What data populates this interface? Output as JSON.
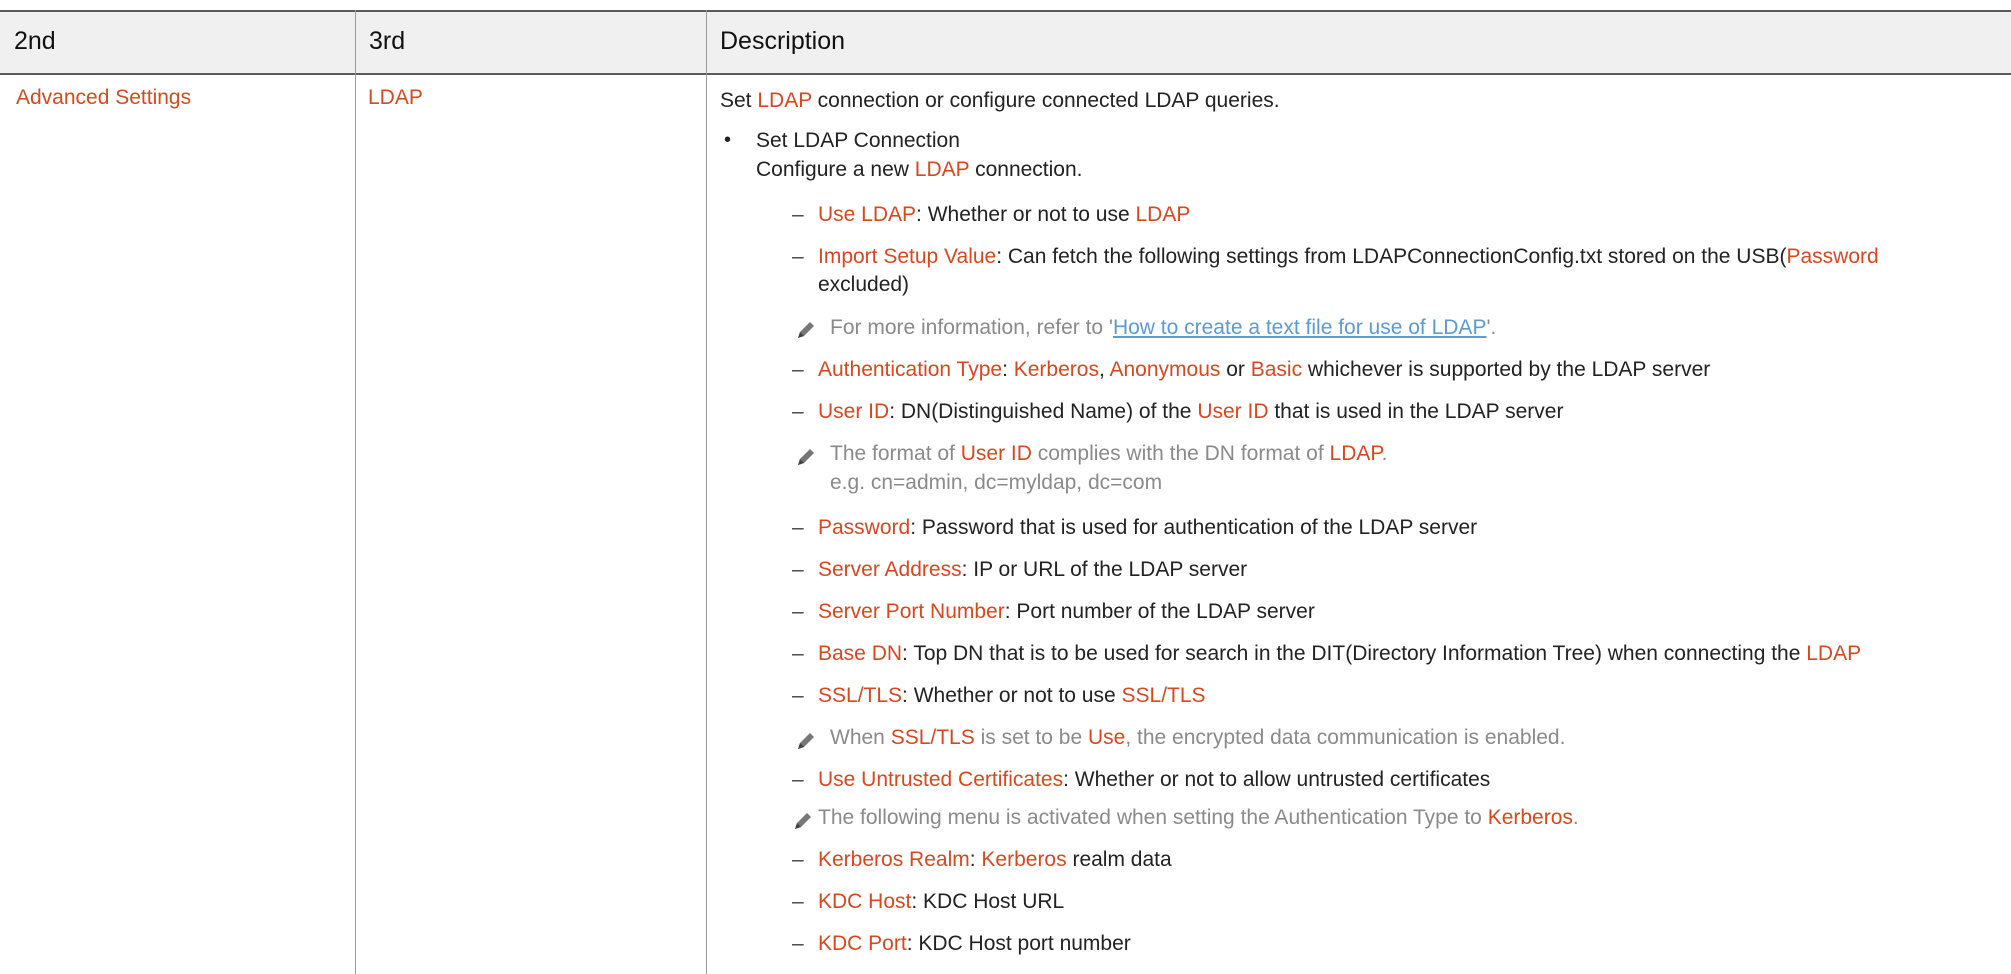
{
  "header": {
    "col_2nd": "2nd",
    "col_3rd": "3rd",
    "col_desc": "Description"
  },
  "row": {
    "second": "Advanced Settings",
    "third": "LDAP"
  },
  "desc": {
    "intro_pre": "Set ",
    "intro_ldap": "LDAP",
    "intro_post": " connection or configure connected LDAP queries.",
    "bullet_title": "Set LDAP Connection",
    "bullet_sub_pre": "Configure a new ",
    "bullet_sub_ldap": "LDAP",
    "bullet_sub_post": " connection.",
    "use_ldap_label": "Use LDAP",
    "use_ldap_text": ": Whether or not to use ",
    "use_ldap_ldap": "LDAP",
    "import_label": "Import Setup Value",
    "import_text": ": Can fetch the following settings from LDAPConnectionConfig.txt stored on the USB(",
    "import_password": "Password",
    "import_excluded": "excluded)",
    "note1_pre": "For more information, refer to '",
    "note1_link": "How to create a text file for use of LDAP",
    "note1_post": "'.",
    "auth_label": "Authentication Type",
    "auth_sep": ": ",
    "auth_kerberos": "Kerberos",
    "auth_comma": ", ",
    "auth_anonymous": "Anonymous",
    "auth_or": " or ",
    "auth_basic": "Basic",
    "auth_post": " whichever is supported by the LDAP server",
    "userid_label": "User ID",
    "userid_text": ": DN(Distinguished Name) of the ",
    "userid_userid": "User ID",
    "userid_post": " that is used in the LDAP server",
    "note2_pre": "The format of ",
    "note2_userid": "User ID",
    "note2_mid": " complies with the DN format of ",
    "note2_ldap": "LDAP",
    "note2_post": ".",
    "note2_example": "e.g. cn=admin, dc=myldap, dc=com",
    "password_label": "Password",
    "password_text": ": Password that is used for authentication of the LDAP server",
    "server_label": "Server Address",
    "server_text": ": IP or URL of the LDAP server",
    "port_label": "Server Port Number",
    "port_text": ": Port number of the LDAP server",
    "basedn_label": "Base DN",
    "basedn_text": ": Top DN that is to be used for search in the DIT(Directory Information Tree) when connecting the ",
    "basedn_ldap": "LDAP",
    "ssl_label": "SSL/TLS",
    "ssl_text": ": Whether or not to use ",
    "ssl_ssl": "SSL/TLS",
    "note3_pre": "When ",
    "note3_ssl": "SSL/TLS",
    "note3_mid": " is set to be ",
    "note3_use": "Use",
    "note3_post": ", the encrypted data communication is enabled.",
    "untrusted_label": "Use Untrusted Certificates",
    "untrusted_text": ": Whether or not to allow untrusted certificates",
    "note4_pre": "The following menu is activated when setting the Authentication Type to ",
    "note4_kerberos": "Kerberos",
    "note4_post": ".",
    "realm_label": "Kerberos Realm",
    "realm_sep": ": ",
    "realm_kerberos": "Kerberos",
    "realm_post": " realm data",
    "kdchost_label": "KDC Host",
    "kdchost_text": ": KDC Host URL",
    "kdcport_label": "KDC Port",
    "kdcport_text": ": KDC Host port number",
    "dash": "–",
    "bullet": "•"
  },
  "colors": {
    "accent": "#d8481f",
    "note": "#8a8a8a",
    "link": "#5b9bd5",
    "header_bg": "#f0f0f0"
  },
  "icons": {
    "note_icon": "pencil-note-icon"
  }
}
